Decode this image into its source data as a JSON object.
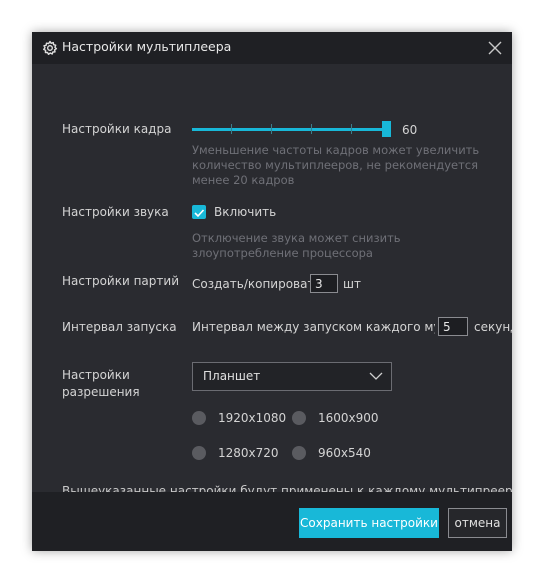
{
  "dialog": {
    "title": "Настройки мультиплеера",
    "icons": {
      "title": "gear-icon",
      "close": "close-icon"
    }
  },
  "frame": {
    "label": "Настройки кадра",
    "value": "60",
    "slider_fraction": 1.0,
    "hint": "Уменьшение частоты кадров может увеличить количество мультиплееров, не рекомендуется менее 20 кадров"
  },
  "sound": {
    "label": "Настройки звука",
    "checkbox_label": "Включить",
    "checked": true,
    "hint": "Отключение звука может снизить злоупотребление процессора"
  },
  "batch": {
    "label": "Настройки партий",
    "prefix": "Создать/копировать",
    "value": "3",
    "suffix": "шт"
  },
  "interval": {
    "label": "Интервал запуска",
    "prefix": "Интервал между запуском каждого мульти",
    "value": "5",
    "suffix": "секунд"
  },
  "resolution": {
    "label": "Настройки разрешения",
    "selected": "Планшет",
    "options": [
      "1920x1080",
      "1600x900",
      "1280x720",
      "960x540"
    ]
  },
  "note": "Вышеуказанные настройки будут применены к каждому мультипрееру",
  "buttons": {
    "save": "Сохранить настройки",
    "cancel": "отмена"
  },
  "colors": {
    "accent": "#18b8d8",
    "background": "#2a2b30",
    "header": "#1f2024"
  }
}
